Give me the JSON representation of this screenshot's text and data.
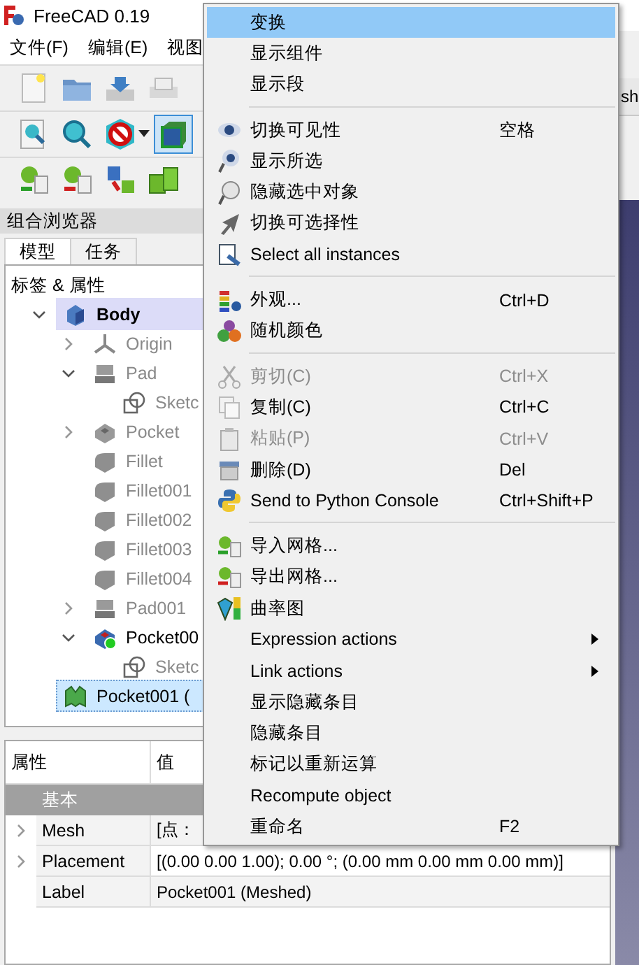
{
  "window": {
    "title": "FreeCAD 0.19"
  },
  "menubar": [
    "文件(F)",
    "编辑(E)",
    "视图"
  ],
  "toolbars": [
    {
      "buttons": [
        {
          "selected": false
        },
        {
          "selected": false
        },
        {
          "selected": false
        },
        {
          "selected": false
        }
      ]
    },
    {
      "buttons": [
        {
          "selected": false
        },
        {
          "selected": false
        },
        {
          "selected": false,
          "dropdown": true
        },
        {
          "selected": true
        }
      ]
    },
    {
      "buttons": [
        {
          "selected": false
        },
        {
          "selected": false
        },
        {
          "selected": false
        },
        {
          "selected": false
        }
      ]
    }
  ],
  "combo_view": {
    "title": "组合浏览器",
    "tabs": [
      {
        "label": "模型",
        "selected": true
      },
      {
        "label": "任务",
        "selected": false
      }
    ],
    "tree": {
      "header": "标签 & 属性",
      "items": [
        {
          "label": "Body",
          "kind": "body",
          "hidden": false,
          "selected": false,
          "active": true,
          "expanded": true,
          "children": [
            {
              "label": "Origin",
              "kind": "origin",
              "hidden": true,
              "selected": false,
              "active": false,
              "expanded": false
            },
            {
              "label": "Pad",
              "kind": "pad",
              "hidden": true,
              "selected": false,
              "active": false,
              "expanded": true,
              "children": [
                {
                  "label": "Sketc",
                  "kind": "sketch",
                  "hidden": true,
                  "selected": false,
                  "active": false
                }
              ]
            },
            {
              "label": "Pocket",
              "kind": "pocket",
              "hidden": true,
              "selected": false,
              "active": false,
              "expanded": false
            },
            {
              "label": "Fillet",
              "kind": "fillet",
              "hidden": true,
              "selected": false,
              "active": false
            },
            {
              "label": "Fillet001",
              "kind": "fillet",
              "hidden": true,
              "selected": false,
              "active": false
            },
            {
              "label": "Fillet002",
              "kind": "fillet",
              "hidden": true,
              "selected": false,
              "active": false
            },
            {
              "label": "Fillet003",
              "kind": "fillet",
              "hidden": true,
              "selected": false,
              "active": false
            },
            {
              "label": "Fillet004",
              "kind": "fillet",
              "hidden": true,
              "selected": false,
              "active": false
            },
            {
              "label": "Pad001",
              "kind": "pad",
              "hidden": true,
              "selected": false,
              "active": false,
              "expanded": false
            },
            {
              "label": "Pocket00",
              "kind": "tip",
              "hidden": false,
              "selected": false,
              "active": false,
              "expanded": true,
              "children": [
                {
                  "label": "Sketc",
                  "kind": "sketch",
                  "hidden": true,
                  "selected": false,
                  "active": false
                }
              ]
            }
          ]
        },
        {
          "label": "Pocket001 (",
          "kind": "mesh",
          "hidden": false,
          "selected": true,
          "active": false
        }
      ]
    }
  },
  "view_tab": {
    "label": "sh"
  },
  "context_menu": [
    {
      "kind": "item",
      "label": "变换",
      "selected": true,
      "disabled": false
    },
    {
      "kind": "item",
      "label": "显示组件",
      "selected": false,
      "disabled": false
    },
    {
      "kind": "item",
      "label": "显示段",
      "selected": false,
      "disabled": false
    },
    {
      "kind": "separator"
    },
    {
      "kind": "item",
      "label": "切换可见性",
      "shortcut": "空格",
      "selected": false,
      "disabled": false
    },
    {
      "kind": "item",
      "label": "显示所选",
      "selected": false,
      "disabled": false
    },
    {
      "kind": "item",
      "label": "隐藏选中对象",
      "selected": false,
      "disabled": false
    },
    {
      "kind": "item",
      "label": "切换可选择性",
      "selected": false,
      "disabled": false
    },
    {
      "kind": "item",
      "label": "Select all instances",
      "selected": false,
      "disabled": false
    },
    {
      "kind": "separator"
    },
    {
      "kind": "item",
      "label": "外观...",
      "shortcut": "Ctrl+D",
      "selected": false,
      "disabled": false
    },
    {
      "kind": "item",
      "label": "随机颜色",
      "selected": false,
      "disabled": false
    },
    {
      "kind": "separator"
    },
    {
      "kind": "item",
      "label": "剪切(C)",
      "shortcut": "Ctrl+X",
      "selected": false,
      "disabled": true
    },
    {
      "kind": "item",
      "label": "复制(C)",
      "shortcut": "Ctrl+C",
      "selected": false,
      "disabled": false
    },
    {
      "kind": "item",
      "label": "粘贴(P)",
      "shortcut": "Ctrl+V",
      "selected": false,
      "disabled": true
    },
    {
      "kind": "item",
      "label": "删除(D)",
      "shortcut": "Del",
      "selected": false,
      "disabled": false
    },
    {
      "kind": "item",
      "label": "Send to Python Console",
      "shortcut": "Ctrl+Shift+P",
      "selected": false,
      "disabled": false
    },
    {
      "kind": "separator"
    },
    {
      "kind": "item",
      "label": "导入网格...",
      "selected": false,
      "disabled": false
    },
    {
      "kind": "item",
      "label": "导出网格...",
      "selected": false,
      "disabled": false
    },
    {
      "kind": "item",
      "label": "曲率图",
      "selected": false,
      "disabled": false
    },
    {
      "kind": "item",
      "label": "Expression actions",
      "submenu": true,
      "selected": false,
      "disabled": false
    },
    {
      "kind": "item",
      "label": "Link actions",
      "submenu": true,
      "selected": false,
      "disabled": false
    },
    {
      "kind": "item",
      "label": "显示隐藏条目",
      "selected": false,
      "disabled": false
    },
    {
      "kind": "item",
      "label": "隐藏条目",
      "selected": false,
      "disabled": false
    },
    {
      "kind": "item",
      "label": "标记以重新运算",
      "selected": false,
      "disabled": false
    },
    {
      "kind": "item",
      "label": "Recompute object",
      "selected": false,
      "disabled": false
    },
    {
      "kind": "item",
      "label": "重命名",
      "shortcut": "F2",
      "selected": false,
      "disabled": false
    }
  ],
  "property_view": {
    "columns": [
      "属性",
      "值"
    ],
    "group": "基本",
    "rows": [
      {
        "name": "Mesh",
        "value": "[点：",
        "expanded": false
      },
      {
        "name": "Placement",
        "value": "[(0.00 0.00 1.00); 0.00 °; (0.00 mm  0.00 mm  0.00 mm)]",
        "expanded": false
      },
      {
        "name": "Label",
        "value": "Pocket001 (Meshed)"
      }
    ]
  }
}
